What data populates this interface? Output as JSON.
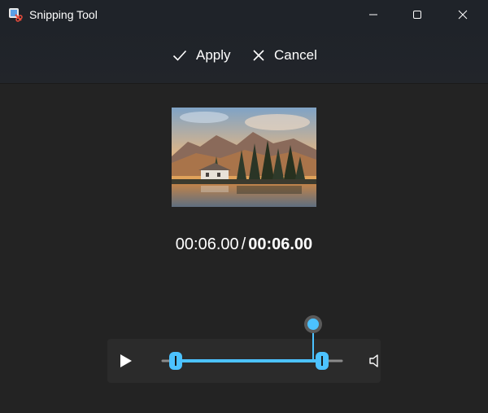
{
  "window": {
    "title": "Snipping Tool",
    "controls": {
      "minimize_icon": "minimize-icon",
      "maximize_icon": "maximize-icon",
      "close_icon": "close-icon"
    }
  },
  "toolbar": {
    "apply_label": "Apply",
    "apply_icon": "checkmark-icon",
    "cancel_label": "Cancel",
    "cancel_icon": "close-icon"
  },
  "preview": {
    "image_subject": "lake-with-mountains-thumbnail"
  },
  "playback": {
    "current_time": "00:06.00",
    "separator": "/",
    "total_time": "00:06.00",
    "play_icon": "play-icon",
    "volume_icon": "volume-icon",
    "trim_start_fraction": 0.0,
    "trim_end_fraction": 1.0,
    "playhead_fraction": 1.0
  },
  "colors": {
    "accent": "#4cc2ff",
    "window_bg": "#232323",
    "titlebar_bg": "#1f2329",
    "controls_bg": "#2b2b2b",
    "text": "#ffffff"
  }
}
